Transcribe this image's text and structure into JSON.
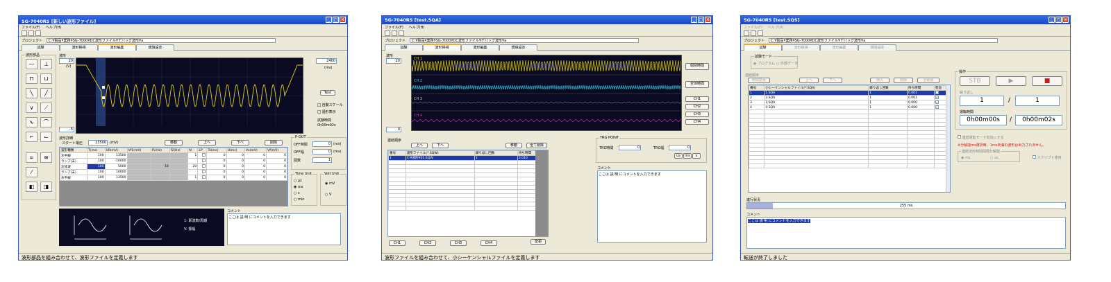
{
  "w1": {
    "title": "SG-7040RS [新しい波形ファイル]",
    "menu": [
      "ファイル(F)",
      "ヘルプ(H)"
    ],
    "project_label": "プロジェクト",
    "project": "C:¥製品¥業務¥SG-7000¥DC波形ファイル¥デバッグ波形¥a",
    "tabs": [
      "試験",
      "波形検視",
      "波形編集",
      "環境設定"
    ],
    "palette_label": "波形部品",
    "wave_label": "波形",
    "amp_top": "20",
    "amp_unit": "(V)",
    "amp_bottom": "-5",
    "time_val": "2400",
    "time_unit": "(ms)",
    "test_btn": "Test",
    "auto_scale": "自動スケール",
    "rect_disp": "謹形表示",
    "test_time_label": "試験時間",
    "test_time": "0h00m02s",
    "detail_label": "波形詳細",
    "start_label": "スタート電圧",
    "start_val": "13500",
    "start_unit": "(mV)",
    "btn_move": "移動",
    "btn_up": "上へ",
    "btn_down": "下へ",
    "btn_del": "削除",
    "cols": [
      "波形種類",
      "T(ms)",
      "V0(mV)",
      "Vf1(mV)",
      "f1(Hz)",
      "f2(Hz)",
      "N",
      "LP",
      "Ts(ms)",
      "U(ms)",
      "Vs(mV)",
      "Vf(mV)"
    ],
    "rows": [
      [
        "水平線",
        "100",
        "13500",
        "",
        "",
        "",
        "1",
        "",
        "0",
        "0",
        "0",
        "0"
      ],
      [
        "ランプ(末)",
        "100",
        "-10000",
        "",
        "",
        "",
        "",
        "",
        "0",
        "0",
        "0",
        "0"
      ],
      [
        "正弦波",
        "100",
        "5000",
        "",
        "10",
        "",
        "20",
        "",
        "0",
        "0",
        "0",
        "0"
      ],
      [
        "ランプ(末)",
        "100",
        "10000",
        "",
        "",
        "",
        "",
        "",
        "0",
        "0",
        "0",
        "0"
      ],
      [
        "水平線",
        "100",
        "13500",
        "",
        "",
        "",
        "1",
        "",
        "0",
        "0",
        "0",
        "0"
      ]
    ],
    "pout_label": "P-OUT",
    "off_time": "OFF時間",
    "off_time_val": "0",
    "off_time_unit": "(ms)",
    "off_width": "OFF幅",
    "off_width_val": "0",
    "off_width_unit": "(ms)",
    "count_label": "回数",
    "count_val": "1",
    "timeunit_label": "Time Unit",
    "timeunit": [
      "µs",
      "ms",
      "s",
      "min"
    ],
    "voltunit_label": "Volt Unit",
    "voltunit": [
      "mV",
      "V"
    ],
    "legend1": "1: 即波数/周期",
    "legend2": "V: 振幅",
    "comment_label": "コメント",
    "comment": "ここは 説 明 にコメントを入力できます",
    "status": "波形部品を組み合わせて、波形ファイルを定義します"
  },
  "w2": {
    "title": "SG-7040RS [test.SQA]",
    "menu": [
      "ファイル(F)",
      "ヘルプ(H)"
    ],
    "project_label": "プロジェクト",
    "project": "C:¥製品¥業務¥SG-7000¥DC波形ファイル¥デバッグ波形¥a",
    "tabs": [
      "試験",
      "波形検視",
      "波形編集",
      "環境設定"
    ],
    "wave_label": "波形",
    "amp_top": "20",
    "amp_bottom": "0",
    "ch_labels": [
      "CH 1",
      "CH 2",
      "CH 3",
      "CH 4"
    ],
    "btn_individual": "個別時間",
    "btn_overall": "全体時間",
    "ch_btns": [
      "CH1",
      "CH2",
      "CH3",
      "CH4"
    ],
    "seq_label": "連結順序",
    "btn_up": "上へ",
    "btn_down": "下へ",
    "btn_move": "移動",
    "btn_delall": "全て削除",
    "cols": [
      "番号",
      "波形ファイル(*.SQW)",
      "繰り返し回数",
      "待ち時間"
    ],
    "row": [
      "1",
      "C:¥波形¥01.SQW",
      "1",
      "0.010"
    ],
    "trg_label": "TRG POINT",
    "trg_time": "TRG時間",
    "trg_time_val": "0",
    "trg_width": "TRG幅",
    "trg_width_val": "0",
    "trg_units": [
      "us",
      "ms",
      "s"
    ],
    "comment_label": "コメント",
    "comment": "ここは 説 明 にコメントを入力できます",
    "ch_tabs": [
      "CH1",
      "CH2",
      "CH3",
      "CH4"
    ],
    "btn_change": "変更",
    "status": "波形ファイルを組み合わせて、小シーケンシャルファイルを定義します"
  },
  "w3": {
    "title": "SG-7040RS [test.SQS]",
    "menu": [
      "ファイル(F)",
      "ヘルプ(H)"
    ],
    "project_label": "プロジェクト",
    "project": "C:¥製品¥業務¥SG-7000¥DC波形ファイル¥デバッグ波形¥a",
    "tabs": [
      "試験",
      "波形検視",
      "波形編集",
      "環境設定"
    ],
    "mode_label": "試験モード",
    "modes": [
      "プログラム",
      "外部データ"
    ],
    "seq_label": "連結順序",
    "btn_edit": "時間変更",
    "btn_up": "上へ",
    "btn_down": "下へ",
    "btn_insert": "挿入",
    "btn_del": "削除",
    "btn_delall": "全削除",
    "cols": [
      "番号",
      "小シーケンシャルファイル(*.SQA)",
      "繰り返し回数",
      "待ち時間",
      "有効"
    ],
    "rows": [
      [
        "1",
        "1.SQA",
        "1",
        "0.001"
      ],
      [
        "2",
        "2.SQA",
        "1",
        "0.001"
      ],
      [
        "3",
        "3.SQA",
        "1",
        "0.000"
      ],
      [
        "4",
        "4.SQA",
        "1",
        "0.000"
      ]
    ],
    "ctrl_label": "操作",
    "stb": "STB",
    "count_label": "繰り返し",
    "count_cur": "1",
    "count_total": "1",
    "time_label": "運転時間",
    "time_cur": "0h00m00s",
    "time_total": "0h00m02s",
    "chk_label": "連続運転モード有効にする",
    "warn": "※分解能ms選択時、1ms未満の波形は出力されません。",
    "time_mode_label": "連続波形時間間隔分解能",
    "time_modes": [
      "ms",
      "us"
    ],
    "ext_label": "スクリプト使用",
    "progress_label": "進行状況",
    "progress_text": "255 ms",
    "progress_frac": 0.08,
    "comment_label": "コメント",
    "comment": "ここは 説 明 にコメントを入力できます",
    "status": "転送が終了しました"
  },
  "colors": {
    "title": "#2456d2",
    "wave_yellow": "#e0d21c",
    "wave_cyan": "#30c8e0",
    "wave_magenta": "#d030b0",
    "stop_red": "#d01818",
    "sel_blue": "#1c3aa8"
  }
}
